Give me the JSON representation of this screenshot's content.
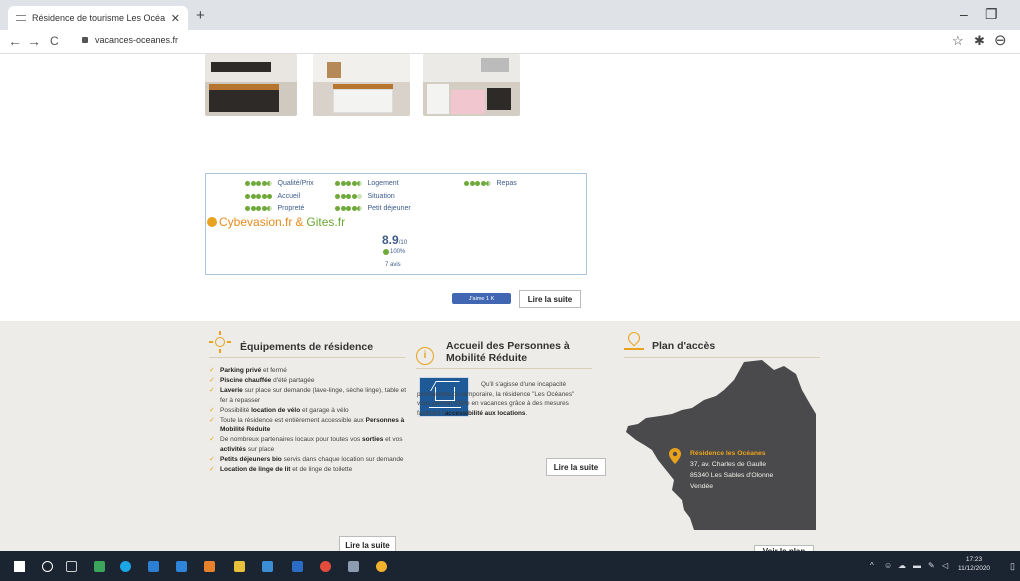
{
  "browser": {
    "tab_title": "Résidence de tourisme Les Océa",
    "tab_close": "✕",
    "new_tab": "+",
    "url": "vacances-oceanes.fr",
    "nav": {
      "back": "←",
      "forward": "→",
      "reload": "C"
    },
    "window": {
      "minimize": "–",
      "maximize": "❐"
    },
    "toolbar": {
      "star": "☆",
      "extensions": "✱",
      "profile": "⊖"
    }
  },
  "reviews": {
    "ratings": [
      {
        "label": "Qualité/Prix",
        "score": 4.5
      },
      {
        "label": "Accueil",
        "score": 5
      },
      {
        "label": "Propreté",
        "score": 4.5
      },
      {
        "label": "Logement",
        "score": 4.5
      },
      {
        "label": "Situation",
        "score": 4
      },
      {
        "label": "Petit déjeuner",
        "score": 4.5
      },
      {
        "label": "Repas",
        "score": 4.5
      }
    ],
    "brand_1": "Cybevasion.fr",
    "brand_amp": "&",
    "brand_2": "Gites.fr",
    "score": "8.9",
    "score_max": "/10",
    "percent": "100%",
    "count": "7 avis"
  },
  "social": {
    "like_label": "J'aime 1 K"
  },
  "read_more": "Lire la suite",
  "equipements": {
    "title": "Équipements de résidence",
    "items": [
      {
        "bold": "Parking privé",
        "text": " et fermé"
      },
      {
        "bold": "Piscine chauffée",
        "text": " d'été partagée"
      },
      {
        "bold": "Laverie",
        "text": " sur place sur demande (lave-linge, sèche linge), table et fer à repasser"
      },
      {
        "bold": "",
        "text": "Possibilité ",
        "bold2": "location de vélo",
        "text2": " et garage à vélo"
      },
      {
        "bold": "",
        "text": "Toute la résidence est entièrement accessible aux ",
        "bold2": "Personnes à Mobilité Réduite",
        "text2": ""
      },
      {
        "bold": "",
        "text": "De nombreux partenaires locaux pour toutes vos ",
        "bold2": "sorties",
        "text2": " et vos ",
        "bold3": "activités",
        "text3": " sur place"
      },
      {
        "bold": "Petits déjeuners bio",
        "text": " servis dans chaque location sur demande"
      },
      {
        "bold": "Location de linge de lit",
        "text": " et de linge de toilette"
      }
    ],
    "button": "Lire la suite"
  },
  "accueil": {
    "title_line1": "Accueil des Personnes à",
    "title_line2": "Mobilité Réduite",
    "text_pre": "Qu'il s'agisse d'une incapacité permanente ou temporaire, la résidence \"Les Océanes\" vous permet d'être en vacances grâce à des mesures facilitant l'",
    "text_bold": "accessibilité aux locations",
    "text_post": ".",
    "button": "Lire la suite"
  },
  "plan": {
    "title": "Plan d'accès",
    "residence": "Résidence les Océanes",
    "address_1": "37, av. Charles de Gaulle",
    "address_2": "85340 Les Sables d'Olonne",
    "address_3": "Vendée",
    "button": "Voir le plan"
  },
  "taskbar": {
    "time": "17:23",
    "date": "11/12/2020"
  },
  "colors": {
    "accent": "#e9a21c",
    "rating_green": "#6ea93a",
    "link_blue": "#3d5c8a",
    "map_gray": "#4a4a4c"
  }
}
